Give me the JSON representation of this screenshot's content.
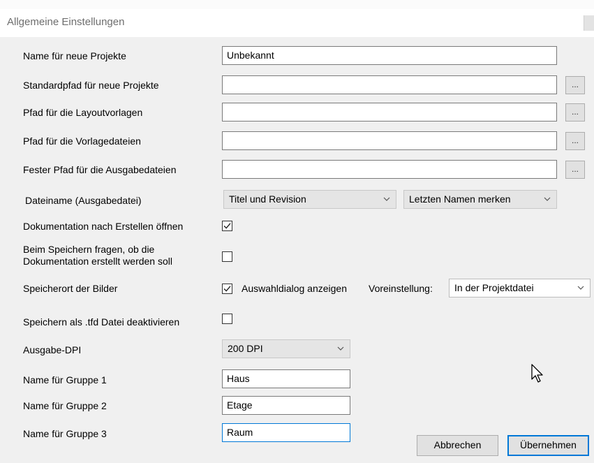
{
  "dialog": {
    "title": "Allgemeine Einstellungen"
  },
  "fields": {
    "project_name": {
      "label": "Name für neue Projekte",
      "value": "Unbekannt"
    },
    "default_path": {
      "label": "Standardpfad für neue Projekte",
      "value": "",
      "browse": "..."
    },
    "layout_path": {
      "label": "Pfad für die Layoutvorlagen",
      "value": "",
      "browse": "..."
    },
    "template_path": {
      "label": "Pfad für die Vorlagedateien",
      "value": "",
      "browse": "..."
    },
    "output_path": {
      "label": "Fester Pfad für die Ausgabedateien",
      "value": "",
      "browse": "..."
    },
    "filename": {
      "label": "Dateiname (Ausgabedatei)",
      "combo1": "Titel und Revision",
      "combo2": "Letzten Namen merken"
    },
    "open_docs": {
      "label": "Dokumentation nach Erstellen öffnen",
      "checked": true
    },
    "ask_on_save": {
      "label_line1": "Beim Speichern fragen, ob die",
      "label_line2": "Dokumentation erstellt werden soll",
      "checked": false
    },
    "image_location": {
      "label": "Speicherort der Bilder",
      "checkbox_label": "Auswahldialog anzeigen",
      "checked": true,
      "preset_label": "Voreinstellung:",
      "preset_value": "In der Projektdatei"
    },
    "disable_tfd": {
      "label": "Speichern als .tfd Datei deaktivieren",
      "checked": false
    },
    "dpi": {
      "label": "Ausgabe-DPI",
      "value": "200 DPI"
    },
    "group1": {
      "label": "Name für Gruppe 1",
      "value": "Haus"
    },
    "group2": {
      "label": "Name für Gruppe 2",
      "value": "Etage"
    },
    "group3": {
      "label": "Name für Gruppe 3",
      "value": "Raum"
    }
  },
  "buttons": {
    "cancel": "Abbrechen",
    "apply": "Übernehmen"
  },
  "colors": {
    "accent": "#0078d7",
    "dialog_bg": "#f0f0f0"
  }
}
